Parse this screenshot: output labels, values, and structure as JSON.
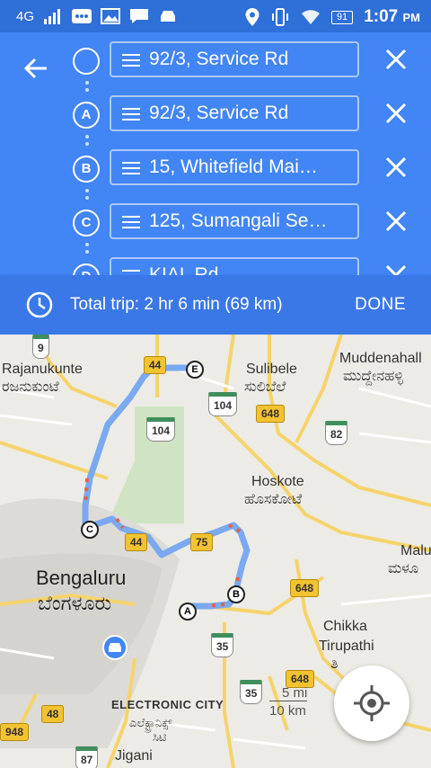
{
  "status_bar": {
    "network": "4G",
    "battery": "91",
    "time": "1:07",
    "ampm": "PM"
  },
  "route": {
    "stops": [
      {
        "marker": "",
        "text": "92/3, Service Rd"
      },
      {
        "marker": "A",
        "text": "92/3, Service Rd"
      },
      {
        "marker": "B",
        "text": "15, Whitefield Mai…"
      },
      {
        "marker": "C",
        "text": "125, Sumangali Se…"
      },
      {
        "marker": "D",
        "text": "KIAL Rd"
      }
    ]
  },
  "trip": {
    "summary": "Total trip: 2 hr 6 min  (69 km)",
    "done_label": "DONE"
  },
  "map": {
    "labels": {
      "rajanukunte": "Rajanukunte",
      "rajanukunte_kn": "ರಜನುಕುಂಟೆ",
      "sulibele": "Sulibele",
      "sulibele_kn": "ಸುಲಿಬೆಲೆ",
      "muddenahalli": "Muddenahall",
      "muddenahalli_kn": "ಮುದ್ದೇನಹಳ್ಳಿ",
      "hoskote": "Hoskote",
      "hoskote_kn": "ಹೊಸಕೋಟೆ",
      "bengaluru": "Bengaluru",
      "bengaluru_kn": "ಬೆಂಗಳೂರು",
      "malu": "Malu",
      "malu_kn": "ಮಳೂ",
      "chikka": "Chikka",
      "tirupathi": "Tirupathi",
      "tirupathi_kn": "ತಿ",
      "electronic_city": "ELECTRONIC CITY",
      "electronic_city_kn": "ಎಲೆಕ್ಟ್ರಾನಿಕ್ಸ್",
      "electronic_city_kn2": "ಸಿಟಿ",
      "jigani": "Jigani"
    },
    "shields": {
      "s9": "9",
      "s44a": "44",
      "s104a": "104",
      "s104b": "104",
      "s648a": "648",
      "s82": "82",
      "s44b": "44",
      "s75": "75",
      "s648b": "648",
      "s35a": "35",
      "s648c": "648",
      "s35b": "35",
      "s48": "48",
      "s948": "948",
      "s87": "87"
    },
    "waypoints": {
      "a": "A",
      "b": "B",
      "c": "C",
      "e": "E"
    },
    "scale": {
      "mi": "5 mi",
      "km": "10 km"
    },
    "colors": {
      "route": "#7aa9f0",
      "traffic": "#e0644a"
    }
  }
}
